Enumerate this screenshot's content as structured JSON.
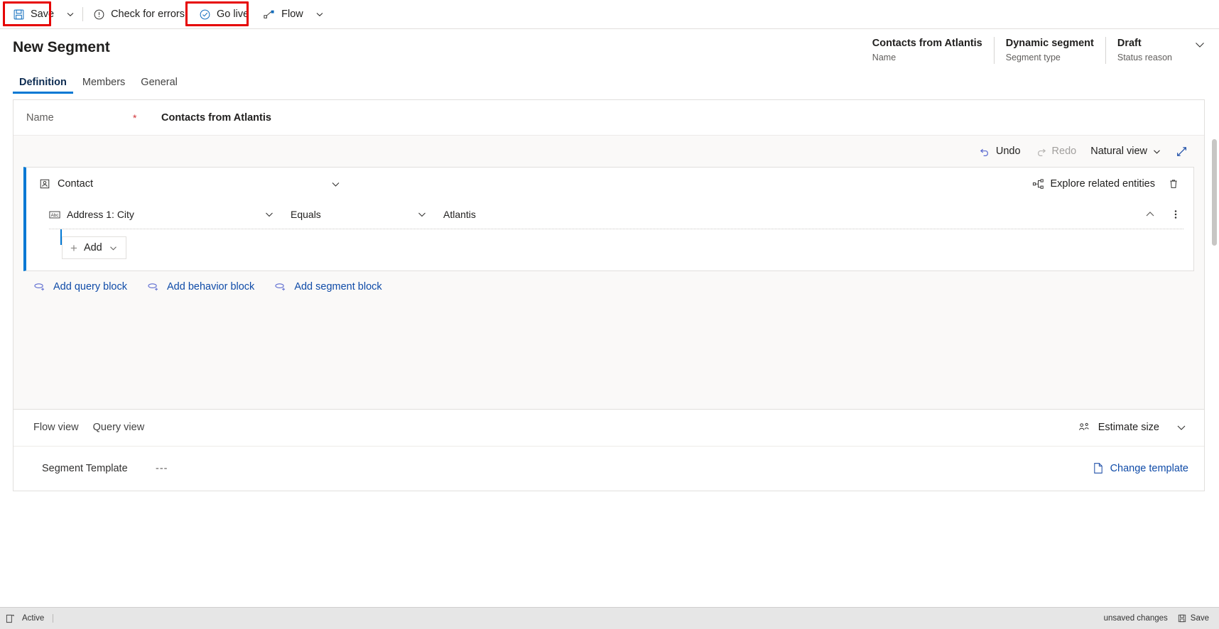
{
  "command_bar": {
    "items": [
      {
        "label": "Save",
        "icon": "save-icon",
        "highlighted": true
      },
      {
        "label": "Check for errors",
        "icon": "error-circle-icon"
      },
      {
        "label": "Go live",
        "icon": "check-circle-icon",
        "highlighted": true
      },
      {
        "label": "Flow",
        "icon": "flow-icon"
      }
    ],
    "save_caret": "⌄",
    "flow_caret": "⌄"
  },
  "header": {
    "title": "New Segment",
    "meta": [
      {
        "value": "Contacts from Atlantis",
        "label": "Name"
      },
      {
        "value": "Dynamic segment",
        "label": "Segment type"
      },
      {
        "value": "Draft",
        "label": "Status reason"
      }
    ]
  },
  "tabs": [
    {
      "label": "Definition",
      "active": true
    },
    {
      "label": "Members",
      "active": false
    },
    {
      "label": "General",
      "active": false
    }
  ],
  "name_field": {
    "label": "Name",
    "required_marker": "*",
    "value": "Contacts from Atlantis"
  },
  "designer_toolbar": {
    "undo": "Undo",
    "redo": "Redo",
    "view_mode": "Natural view",
    "view_caret": "⌄",
    "expand_icon": "expand-icon"
  },
  "block": {
    "entity": "Contact",
    "entity_icon": "contact-entity-icon",
    "collapse_caret": "⌄",
    "explore_label": "Explore related entities",
    "explore_icon": "related-entities-icon",
    "delete_icon": "trash-icon",
    "condition": {
      "field": "Address 1: City",
      "field_icon": "text-attribute-icon",
      "operator": "Equals",
      "value": "Atlantis",
      "collapse_icon": "chevron-up-icon",
      "more_icon": "more-vertical-icon"
    },
    "add_button": {
      "label": "Add",
      "plus": "+",
      "caret": "⌄"
    }
  },
  "block_links": [
    {
      "label": "Add query block",
      "icon": "add-query-block-icon"
    },
    {
      "label": "Add behavior block",
      "icon": "add-behavior-block-icon"
    },
    {
      "label": "Add segment block",
      "icon": "add-segment-block-icon"
    }
  ],
  "footer": {
    "view_tabs": [
      {
        "label": "Flow view"
      },
      {
        "label": "Query view"
      }
    ],
    "estimate": {
      "label": "Estimate size",
      "icon": "people-icon",
      "caret": "⌄"
    },
    "template": {
      "label": "Segment Template",
      "value": "---",
      "change_label": "Change template",
      "change_icon": "page-icon"
    }
  },
  "status_bar": {
    "status_icon": "form-icon",
    "status": "Active",
    "unsaved": "unsaved changes",
    "save": "Save",
    "save_icon": "save-icon"
  },
  "colors": {
    "accent": "#0078d4",
    "link": "#0f4ba8",
    "highlight": "#e60000",
    "required": "#d13438",
    "designer_bg": "#faf9f8"
  }
}
